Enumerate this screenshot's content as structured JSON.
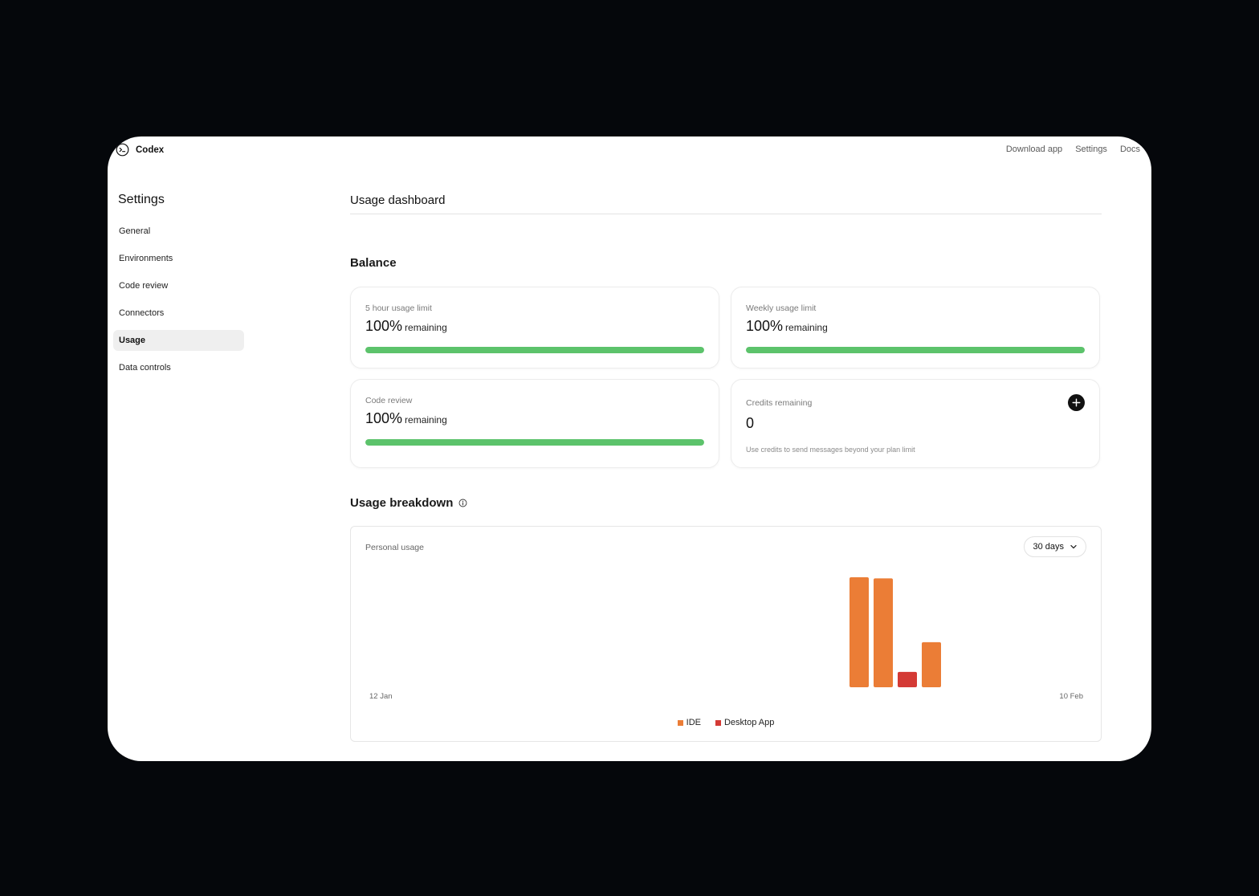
{
  "app": {
    "name": "Codex",
    "logo_icon": "terminal-icon"
  },
  "topnav": {
    "download": "Download app",
    "settings": "Settings",
    "docs": "Docs"
  },
  "sidebar": {
    "title": "Settings",
    "items": [
      {
        "label": "General",
        "active": false
      },
      {
        "label": "Environments",
        "active": false
      },
      {
        "label": "Code review",
        "active": false
      },
      {
        "label": "Connectors",
        "active": false
      },
      {
        "label": "Usage",
        "active": true
      },
      {
        "label": "Data controls",
        "active": false
      }
    ]
  },
  "main": {
    "title": "Usage dashboard",
    "balance": {
      "heading": "Balance",
      "cards": [
        {
          "label": "5 hour usage limit",
          "value": "100%",
          "suffix": "remaining",
          "fraction": 1.0
        },
        {
          "label": "Weekly usage limit",
          "value": "100%",
          "suffix": "remaining",
          "fraction": 1.0
        },
        {
          "label": "Code review",
          "value": "100%",
          "suffix": "remaining",
          "fraction": 1.0
        }
      ],
      "credits": {
        "label": "Credits remaining",
        "value": "0",
        "note": "Use credits to send messages beyond your plan limit",
        "add_icon": "plus-icon"
      }
    },
    "breakdown": {
      "heading": "Usage breakdown",
      "info_icon": "info-icon",
      "panel_label": "Personal usage",
      "range": "30 days"
    }
  },
  "colors": {
    "accent_green": "#5cc36b",
    "ide": "#eb7d36",
    "desktop": "#d43a35"
  },
  "chart_data": {
    "type": "bar",
    "x_start": "12 Jan",
    "x_end": "10 Feb",
    "days": 30,
    "series": [
      {
        "name": "IDE",
        "color": "#eb7d36",
        "points": [
          {
            "day_index": 20,
            "value": 100
          },
          {
            "day_index": 21,
            "value": 99
          },
          {
            "day_index": 23,
            "value": 41
          }
        ]
      },
      {
        "name": "Desktop App",
        "color": "#d43a35",
        "points": [
          {
            "day_index": 22,
            "value": 14
          }
        ]
      }
    ],
    "legend": [
      "IDE",
      "Desktop App"
    ],
    "legend_position": "bottom"
  }
}
